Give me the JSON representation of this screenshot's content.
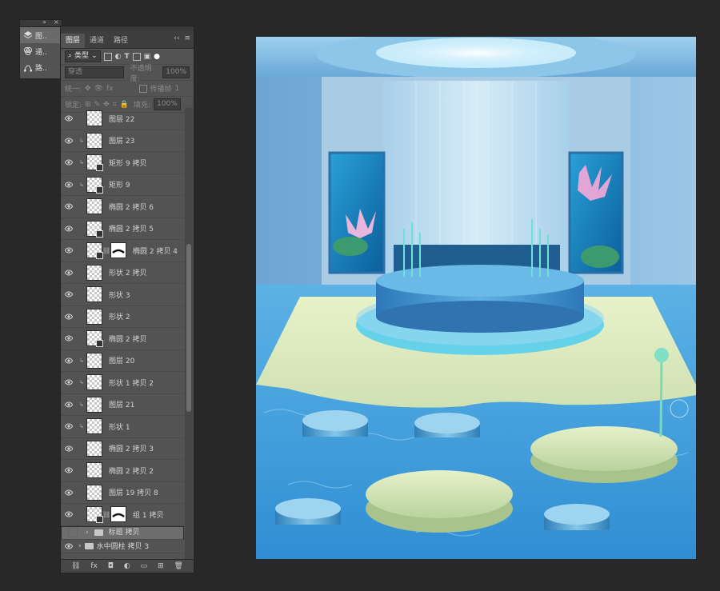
{
  "mini_panel": {
    "collapse_glyph": "»",
    "close_glyph": "×",
    "items": [
      {
        "icon": "layers-icon",
        "label": "图.."
      },
      {
        "icon": "channels-icon",
        "label": "通.."
      },
      {
        "icon": "paths-icon",
        "label": "路.."
      }
    ]
  },
  "layers_panel": {
    "tabs": [
      {
        "label": "图层"
      },
      {
        "label": "通道"
      },
      {
        "label": "路径"
      }
    ],
    "collapse_glyph": "‹‹",
    "menu_glyph": "≡",
    "filter_kind": "类型",
    "blend_mode": "穿透",
    "opacity_label": "不透明度:",
    "opacity_value": "100%",
    "unify_label": "统一:",
    "propagate_label": "传播帧",
    "propagate_value": "1",
    "lock_label": "锁定:",
    "fill_label": "填充:",
    "fill_value": "100%",
    "layers": [
      {
        "name": "图层 22"
      },
      {
        "name": "图层 23"
      },
      {
        "name": "矩形 9 拷贝"
      },
      {
        "name": "矩形 9"
      },
      {
        "name": "椭圆 2 拷贝 6"
      },
      {
        "name": "椭圆 2 拷贝 5"
      },
      {
        "name": "椭圆 2 拷贝 4"
      },
      {
        "name": "形状 2 拷贝"
      },
      {
        "name": "形状 3"
      },
      {
        "name": "形状 2"
      },
      {
        "name": "椭圆 2 拷贝"
      },
      {
        "name": "图层 20"
      },
      {
        "name": "形状 1 拷贝 2"
      },
      {
        "name": "图层 21"
      },
      {
        "name": "形状 1"
      },
      {
        "name": "椭圆 2 拷贝 3"
      },
      {
        "name": "椭圆 2 拷贝 2"
      },
      {
        "name": "图层 19 拷贝 8"
      },
      {
        "name": "组 1 拷贝"
      }
    ],
    "groups": [
      {
        "name": "标题 拷贝"
      },
      {
        "name": "水中圆柱 拷贝 3"
      }
    ],
    "bottom_tools": [
      "⛓",
      "fx",
      "◘",
      "◐",
      "▭",
      "⊞",
      "🗑"
    ]
  },
  "colors": {
    "app_bg": "#282828",
    "panel_bg": "#535353",
    "selected_row": "#6d6d6d",
    "water": "#3f9fd8",
    "lily_green": "#d8eab8",
    "platform_blue": "#3a8fd0"
  }
}
